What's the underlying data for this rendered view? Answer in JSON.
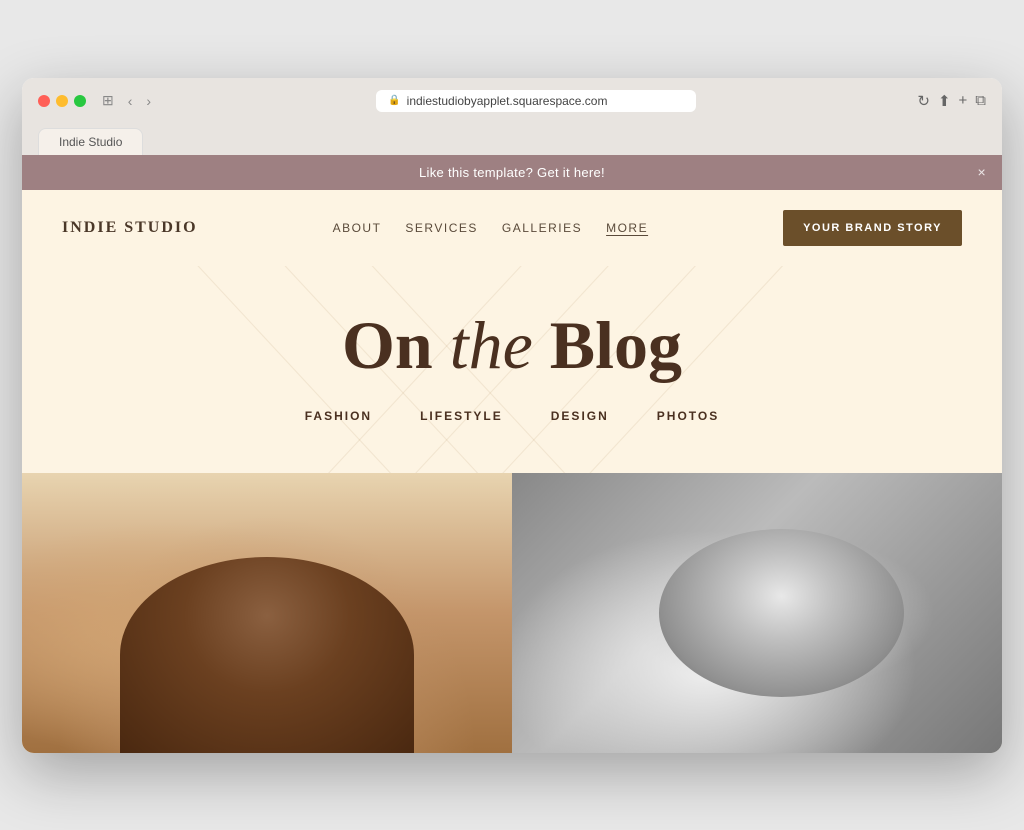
{
  "browser": {
    "url": "indiestudiobyapplet.squarespace.com",
    "tab_label": "Indie Studio"
  },
  "banner": {
    "text": "Like this template? Get it here!",
    "close_label": "×"
  },
  "nav": {
    "logo": "INDIE STUDIO",
    "links": [
      {
        "label": "ABOUT",
        "active": false
      },
      {
        "label": "SERVICES",
        "active": false
      },
      {
        "label": "GALLERIES",
        "active": false
      },
      {
        "label": "MORE",
        "active": true
      }
    ],
    "cta_label": "YOUR BRAND STORY"
  },
  "hero": {
    "title_prefix": "On ",
    "title_italic": "the",
    "title_suffix": " Blog",
    "categories": [
      {
        "label": "FASHION",
        "bold": false
      },
      {
        "label": "LIFESTYLE",
        "bold": false
      },
      {
        "label": "DESIGN",
        "bold": true
      },
      {
        "label": "PHOTOS",
        "bold": false
      }
    ]
  },
  "images": {
    "left_alt": "Warm toned portrait photo",
    "right_alt": "Black and white portrait photo"
  },
  "colors": {
    "banner_bg": "#9e8082",
    "page_bg": "#fdf4e3",
    "cta_bg": "#6b4f2a",
    "text_dark": "#4a3020",
    "content_bg": "#f5ead0"
  }
}
